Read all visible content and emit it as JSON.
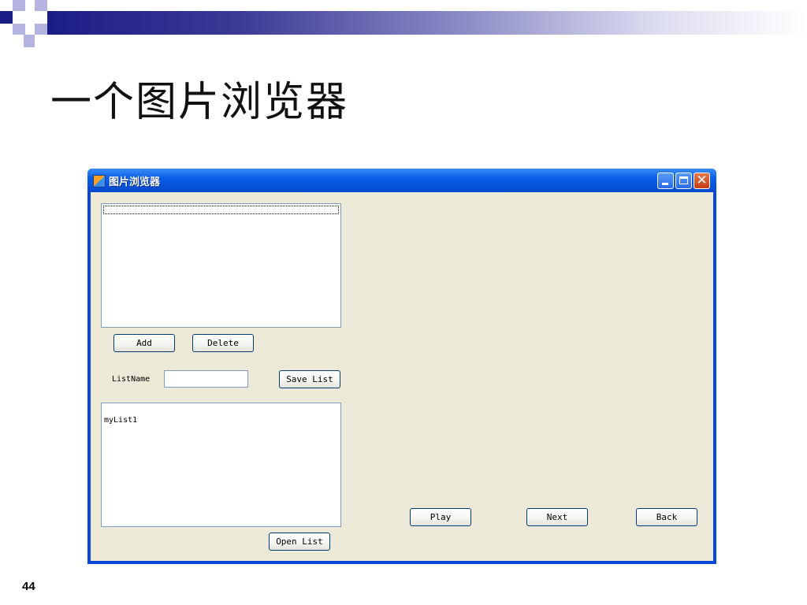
{
  "slide": {
    "title": "一个图片浏览器",
    "page_number": "44",
    "colors": {
      "accent": "#1c1c86",
      "accent_light": "#b4b4e0"
    }
  },
  "window": {
    "title": "图片浏览器",
    "icon": "app-icon",
    "controls": {
      "minimize": "minimize-icon",
      "maximize": "maximize-icon",
      "close": "close-icon"
    },
    "colors": {
      "titlebar": "#0a5ee8",
      "client_background": "#ece9d8"
    }
  },
  "image_list": {
    "items": []
  },
  "buttons": {
    "add": "Add",
    "delete": "Delete",
    "save_list": "Save List",
    "open_list": "Open List",
    "play": "Play",
    "next": "Next",
    "back": "Back"
  },
  "list_name": {
    "label": "ListName",
    "value": ""
  },
  "saved_lists": {
    "items": [
      "myList1"
    ]
  }
}
